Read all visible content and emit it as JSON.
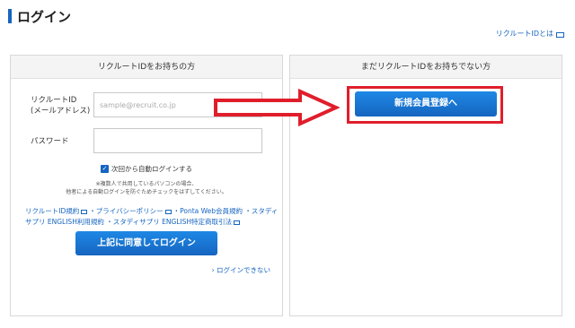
{
  "header": {
    "title": "ログイン",
    "help_link": "リクルートIDとは"
  },
  "left_panel": {
    "heading": "リクルートIDをお持ちの方",
    "id_label_line1": "リクルートID",
    "id_label_line2": "(メールアドレス)",
    "id_placeholder": "sample@recruit.co.jp",
    "password_label": "パスワード",
    "remember_label": "次回から自動ログインする",
    "note_line1": "※複数人で共用しているパソコンの場合、",
    "note_line2": "他者による自動ログインを防ぐためチェックをはずしてください。",
    "policies": [
      "リクルートID規約",
      "プライバシーポリシー",
      "Ponta Web会員規約",
      "スタディサプリ ENGLISH利用規約",
      "スタディサプリ ENGLISH特定商取引法"
    ],
    "login_button": "上記に同意してログイン",
    "cannot_login": "ログインできない"
  },
  "right_panel": {
    "heading": "まだリクルートIDをお持ちでない方",
    "register_button": "新規会員登録へ"
  },
  "annotation": {
    "color": "#e01e2b"
  }
}
